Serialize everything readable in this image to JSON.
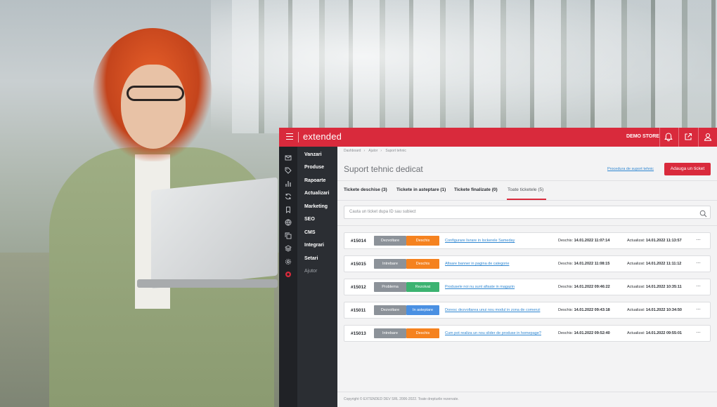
{
  "colors": {
    "brand_red": "#d92a3c",
    "sidebar_bg": "#2b2e33",
    "link_blue": "#2e86d1",
    "status_orange": "#f5821f",
    "status_green": "#3cb371",
    "status_blue": "#4a90e2",
    "type_gray": "#8c9299"
  },
  "topbar": {
    "brand": "extended",
    "store": "DEMO STORE",
    "icons": [
      "menu-icon",
      "bell-icon",
      "external-link-icon",
      "user-icon"
    ]
  },
  "sidebar": {
    "items": [
      {
        "label": "Vanzari",
        "icon": "mail-icon"
      },
      {
        "label": "Produse",
        "icon": "tag-icon"
      },
      {
        "label": "Rapoarte",
        "icon": "bar-chart-icon"
      },
      {
        "label": "Actualizari",
        "icon": "refresh-icon"
      },
      {
        "label": "Marketing",
        "icon": "bookmark-icon"
      },
      {
        "label": "SEO",
        "icon": "globe-icon"
      },
      {
        "label": "CMS",
        "icon": "copy-icon"
      },
      {
        "label": "Integrari",
        "icon": "layers-icon"
      },
      {
        "label": "Setari",
        "icon": "gear-icon"
      },
      {
        "label": "Ajutor",
        "icon": "lifebuoy-icon"
      }
    ]
  },
  "breadcrumb": [
    "Dashboard",
    "Ajutor",
    "Suport tehnic"
  ],
  "page": {
    "title": "Suport tehnic dedicat",
    "procedure_link": "Procedura de suport tehnic",
    "add_button": "Adauga un ticket"
  },
  "tabs": [
    {
      "label": "Tickete deschise (3)"
    },
    {
      "label": "Tickete in asteptare (1)"
    },
    {
      "label": "Tickete finalizate (0)"
    },
    {
      "label": "Toate ticketele (5)",
      "active": true
    }
  ],
  "search": {
    "placeholder": "Cauta un ticket dupa ID sau subiect"
  },
  "labels": {
    "opened": "Deschis:",
    "updated": "Actualizat:",
    "more": "···"
  },
  "tickets": [
    {
      "id": "#15014",
      "type": "Dezvoltare",
      "status": "Deschis",
      "status_color": "#f5821f",
      "subject": "Configurare livrare in lockerele Sameday",
      "opened": "14.01.2022 11:07:14",
      "updated": "14.01.2022 11:13:57"
    },
    {
      "id": "#15015",
      "type": "Intrebare",
      "status": "Deschis",
      "status_color": "#f5821f",
      "subject": "Afisare banner in pagina de categorie",
      "opened": "14.01.2022 11:08:15",
      "updated": "14.01.2022 11:11:12"
    },
    {
      "id": "#15012",
      "type": "Problema",
      "status": "Rezolvat",
      "status_color": "#3cb371",
      "subject": "Produsele noi nu sunt afisate in magazin",
      "opened": "14.01.2022 09:46:22",
      "updated": "14.01.2022 10:35:11"
    },
    {
      "id": "#15011",
      "type": "Dezvoltare",
      "status": "In asteptare",
      "status_color": "#4a90e2",
      "subject": "Doresc dezvoltarea unui nou modul in zona de comenzi",
      "opened": "14.01.2022 09:43:18",
      "updated": "14.01.2022 10:34:50"
    },
    {
      "id": "#15013",
      "type": "Intrebare",
      "status": "Deschis",
      "status_color": "#f5821f",
      "subject": "Cum pot realiza un nou slider de produse in homepage?",
      "opened": "14.01.2022 09:52:40",
      "updated": "14.01.2022 09:55:01"
    }
  ],
  "footer": "Copyright © EXTENDED DEV SRL 2006-2022. Toate drepturile rezervate."
}
